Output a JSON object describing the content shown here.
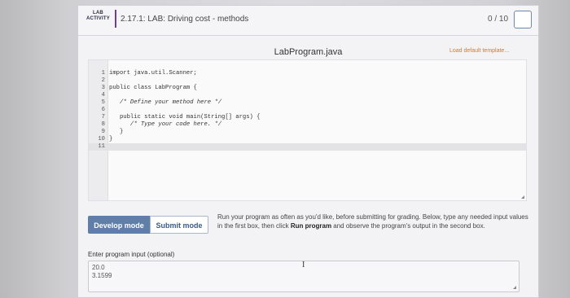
{
  "header": {
    "badge_line1": "LAB",
    "badge_line2": "ACTIVITY",
    "title": "2.17.1: LAB: Driving cost - methods",
    "score": "0 / 10"
  },
  "editor": {
    "filename": "LabProgram.java",
    "load_template_label": "Load default template...",
    "lines": [
      {
        "num": "1",
        "code": "import java.util.Scanner;"
      },
      {
        "num": "2",
        "code": ""
      },
      {
        "num": "3",
        "code": "public class LabProgram {"
      },
      {
        "num": "4",
        "code": ""
      },
      {
        "num": "5",
        "code": "   /* Define your method here */"
      },
      {
        "num": "6",
        "code": ""
      },
      {
        "num": "7",
        "code": "   public static void main(String[] args) {"
      },
      {
        "num": "8",
        "code": "      /* Type your code here. */"
      },
      {
        "num": "9",
        "code": "   }"
      },
      {
        "num": "10",
        "code": "}"
      },
      {
        "num": "11",
        "code": ""
      }
    ]
  },
  "modes": {
    "develop_label": "Develop mode",
    "submit_label": "Submit mode"
  },
  "instructions": {
    "part1": "Run your program as often as you'd like, before submitting for grading. Below, type any needed input values in the first box, then click ",
    "run_program": "Run program",
    "part2": " and observe the program's output in the second box."
  },
  "input": {
    "label": "Enter program input (optional)",
    "line1": "20.0",
    "line2": "3.1599"
  }
}
